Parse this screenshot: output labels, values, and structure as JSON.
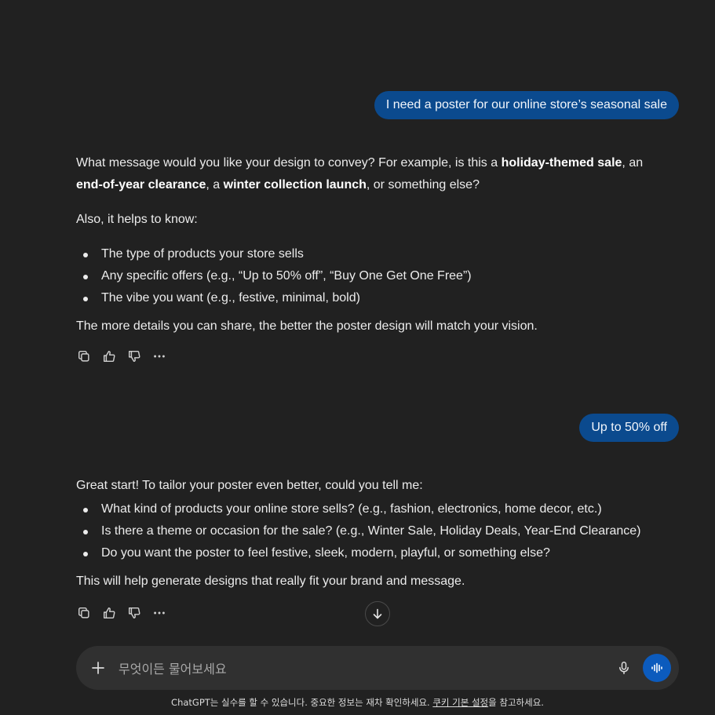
{
  "conversation": {
    "user_message_1": "I need a poster for our online store’s seasonal sale",
    "assistant_1": {
      "para1": {
        "t1": "What message would you like your design to convey? For example, is this a ",
        "b1": "holiday-themed sale",
        "t2": ", an ",
        "b2": "end-of-year clearance",
        "t3": ", a ",
        "b3": "winter collection launch",
        "t4": ", or something else?"
      },
      "para2": "Also, it helps to know:",
      "bullets": [
        "The type of products your store sells",
        "Any specific offers (e.g., “Up to 50% off”, “Buy One Get One Free”)",
        "The vibe you want (e.g., festive, minimal, bold)"
      ],
      "para3": "The more details you can share, the better the poster design will match your vision."
    },
    "user_message_2": "Up to 50% off",
    "assistant_2": {
      "intro": "Great start! To tailor your poster even better, could you tell me:",
      "bullets": [
        "What kind of products your online store sells? (e.g., fashion, electronics, home decor, etc.)",
        "Is there a theme or occasion for the sale? (e.g., Winter Sale, Holiday Deals, Year-End Clearance)",
        "Do you want the poster to feel festive, sleek, modern, playful, or something else?"
      ],
      "outro": "This will help generate designs that really fit your brand and message."
    }
  },
  "action_icons": [
    "copy-icon",
    "thumbs-up-icon",
    "thumbs-down-icon",
    "more-icon"
  ],
  "composer": {
    "placeholder": "무엇이든 물어보세요"
  },
  "footer": {
    "text_before": "ChatGPT는 실수를 할 수 있습니다. 중요한 정보는 재차 확인하세요. ",
    "link": "쿠키 기본 설정",
    "text_after": "을 참고하세요."
  },
  "colors": {
    "background": "#212121",
    "user_bubble": "#0b4a8e",
    "composer": "#303030",
    "voice_button": "#0c5bbd"
  }
}
